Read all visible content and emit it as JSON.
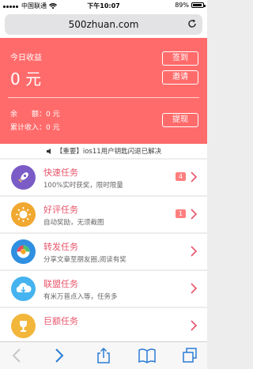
{
  "status_bar": {
    "carrier": "中国联通",
    "time": "下午10:07",
    "battery": "89%",
    "battery_level": 0.89
  },
  "browser": {
    "url": "500zhuan.com"
  },
  "header": {
    "today_label": "今日收益",
    "today_value": "0 元",
    "sign_in_label": "签到",
    "invite_label": "邀请",
    "balance_label": "余　　额：",
    "balance_value": "0 元",
    "total_label": "累计收入：",
    "total_value": "0 元",
    "withdraw_label": "提现"
  },
  "notice": {
    "icon": "speaker-icon",
    "text": "【重要】ios11用户钥匙闪退已解决"
  },
  "tasks": [
    {
      "title": "快速任务",
      "subtitle": "100%实时获奖，限时限量",
      "badge": "4",
      "icon": "rocket-icon",
      "color": "#7b5cc6"
    },
    {
      "title": "好评任务",
      "subtitle": "自动奖励，无须截图",
      "badge": "1",
      "icon": "sun-icon",
      "color": "#f0a830"
    },
    {
      "title": "转发任务",
      "subtitle": "分享文章至朋友圈,阅读有奖",
      "badge": "",
      "icon": "share-circle-icon",
      "color": "#2f8fe0"
    },
    {
      "title": "联盟任务",
      "subtitle": "有米万普点入等，任务多",
      "badge": "",
      "icon": "cloud-download-icon",
      "color": "#45b3ef"
    },
    {
      "title": "巨额任务",
      "subtitle": "",
      "badge": "",
      "icon": "trophy-icon",
      "color": "#f2b63b"
    }
  ],
  "colors": {
    "accent": "#ff6b6b",
    "title": "#e8556b",
    "ios_blue": "#2a7bd6"
  }
}
